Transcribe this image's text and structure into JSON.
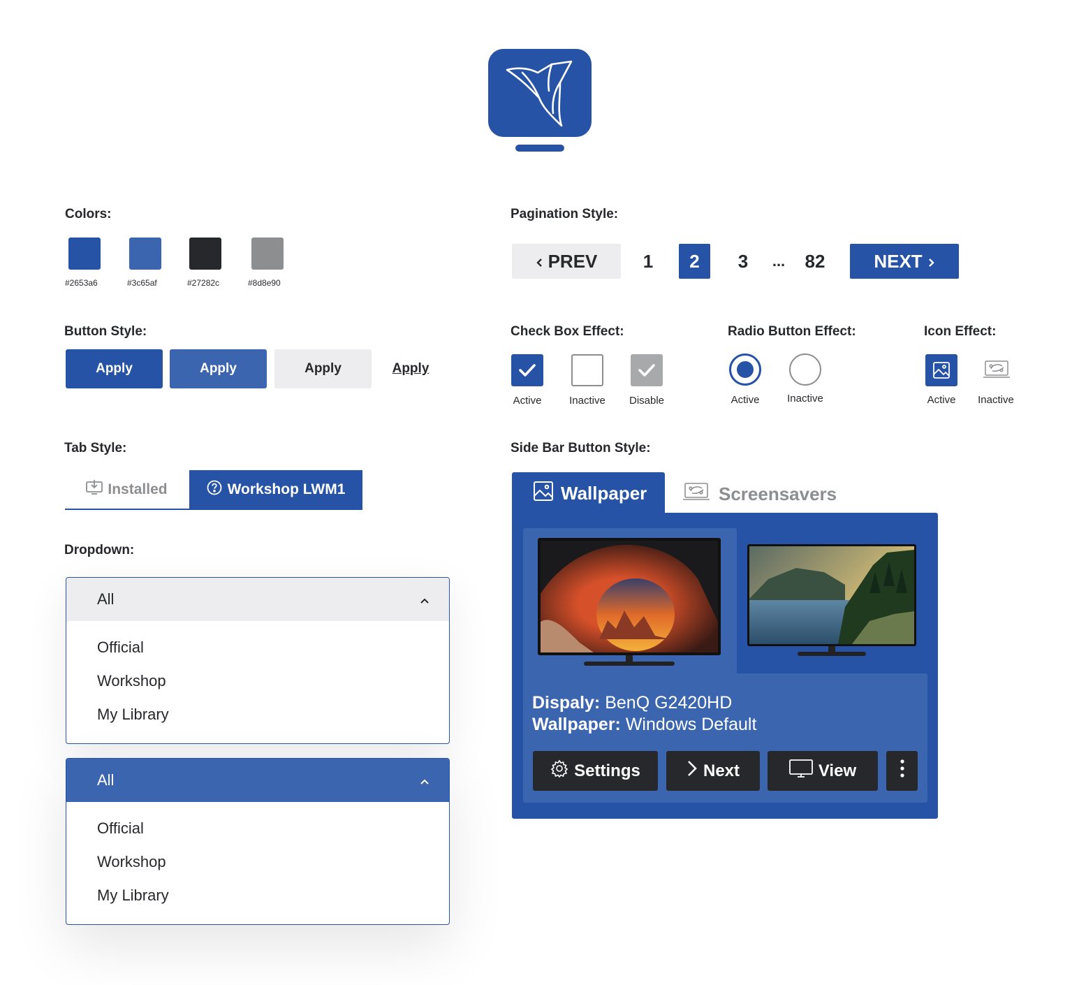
{
  "colors": {
    "heading": "Colors:",
    "swatches": [
      {
        "hex": "#2653a6",
        "label": "#2653a6"
      },
      {
        "hex": "#3c65af",
        "label": "#3c65af"
      },
      {
        "hex": "#27282c",
        "label": "#27282c"
      },
      {
        "hex": "#8d8e90",
        "label": "#8d8e90"
      }
    ]
  },
  "buttons": {
    "heading": "Button Style:",
    "primary": "Apply",
    "secondary": "Apply",
    "neutral": "Apply",
    "link": "Apply"
  },
  "tabs": {
    "heading": "Tab Style:",
    "inactive": "Installed",
    "active": "Workshop LWM1"
  },
  "dropdown": {
    "heading": "Dropdown:",
    "selected": "All",
    "options": [
      "Official",
      "Workshop",
      "My Library"
    ]
  },
  "pagination": {
    "heading": "Pagination Style:",
    "prev": "PREV",
    "pages": [
      "1",
      "2",
      "3"
    ],
    "current": "2",
    "ellipsis": "...",
    "last": "82",
    "next": "NEXT"
  },
  "checkbox": {
    "heading": "Check Box Effect:",
    "active": "Active",
    "inactive": "Inactive",
    "disabled": "Disable"
  },
  "radio": {
    "heading": "Radio Button Effect:",
    "active": "Active",
    "inactive": "Inactive"
  },
  "icon_effect": {
    "heading": "Icon Effect:",
    "active": "Active",
    "inactive": "Inactive"
  },
  "sidebar": {
    "heading": "Side Bar Button Style:",
    "tab_active": "Wallpaper",
    "tab_inactive": "Screensavers",
    "display_label": "Dispaly:",
    "display_value": "BenQ G2420HD",
    "wallpaper_label": "Wallpaper:",
    "wallpaper_value": "Windows Default",
    "settings": "Settings",
    "next": "Next",
    "view": "View"
  }
}
